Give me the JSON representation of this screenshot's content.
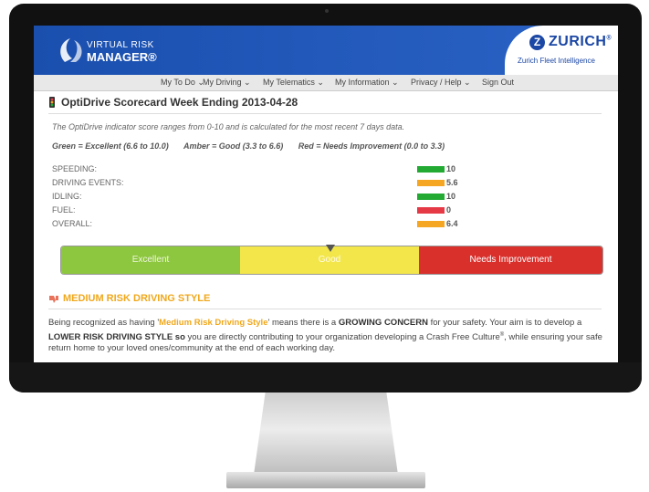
{
  "header": {
    "logo_line1": "VIRTUAL RISK",
    "logo_line2": "MANAGER®",
    "brand_letter": "Z",
    "brand_name": "ZURICH",
    "brand_registered": "®",
    "brand_sub": "Zurich Fleet Intelligence"
  },
  "nav": {
    "items": [
      "My To Do ⌄",
      "My Driving ⌄",
      "My Telematics ⌄",
      "My Information ⌄",
      "Privacy / Help ⌄",
      "Sign Out"
    ]
  },
  "page": {
    "title": "OptiDrive Scorecard Week Ending 2013-04-28",
    "description": "The OptiDrive indicator score ranges from 0-10 and is calculated for the most recent 7 days data.",
    "legend": [
      "Green = Excellent (6.6 to 10.0)",
      "Amber = Good (3.3 to 6.6)",
      "Red = Needs Improvement (0.0 to 3.3)"
    ]
  },
  "scores": [
    {
      "label": "SPEEDING:",
      "value": "10",
      "color": "#22aa33"
    },
    {
      "label": "DRIVING EVENTS:",
      "value": "5.6",
      "color": "#f5a623"
    },
    {
      "label": "IDLING:",
      "value": "10",
      "color": "#22aa33"
    },
    {
      "label": "FUEL:",
      "value": "0",
      "color": "#e63946"
    },
    {
      "label": "OVERALL:",
      "value": "6.4",
      "color": "#f5a623"
    }
  ],
  "gauge": {
    "segments": [
      "Excellent",
      "Good",
      "Needs Improvement"
    ],
    "colors": [
      "#8dc63f",
      "#f2e64a",
      "#d9302c"
    ],
    "pointer_value": 6.4
  },
  "risk": {
    "title": "MEDIUM RISK DRIVING STYLE",
    "p1": "Being recognized as having '",
    "p1_hl": "Medium Risk Driving Style",
    "p2": "' means there is a ",
    "p2_b": "GROWING CONCERN",
    "p3": " for your safety. Your aim is to develop a ",
    "p3_b": "LOWER RISK DRIVING STYLE so",
    "p4": " you are directly contributing to your organization developing a Crash Free Culture",
    "p4_sup": "®",
    "p5": ", while ensuring your safe return home to your loved ones/community at the end of each working day."
  },
  "monitor": {
    "apple_icon": "apple-logo-icon"
  }
}
